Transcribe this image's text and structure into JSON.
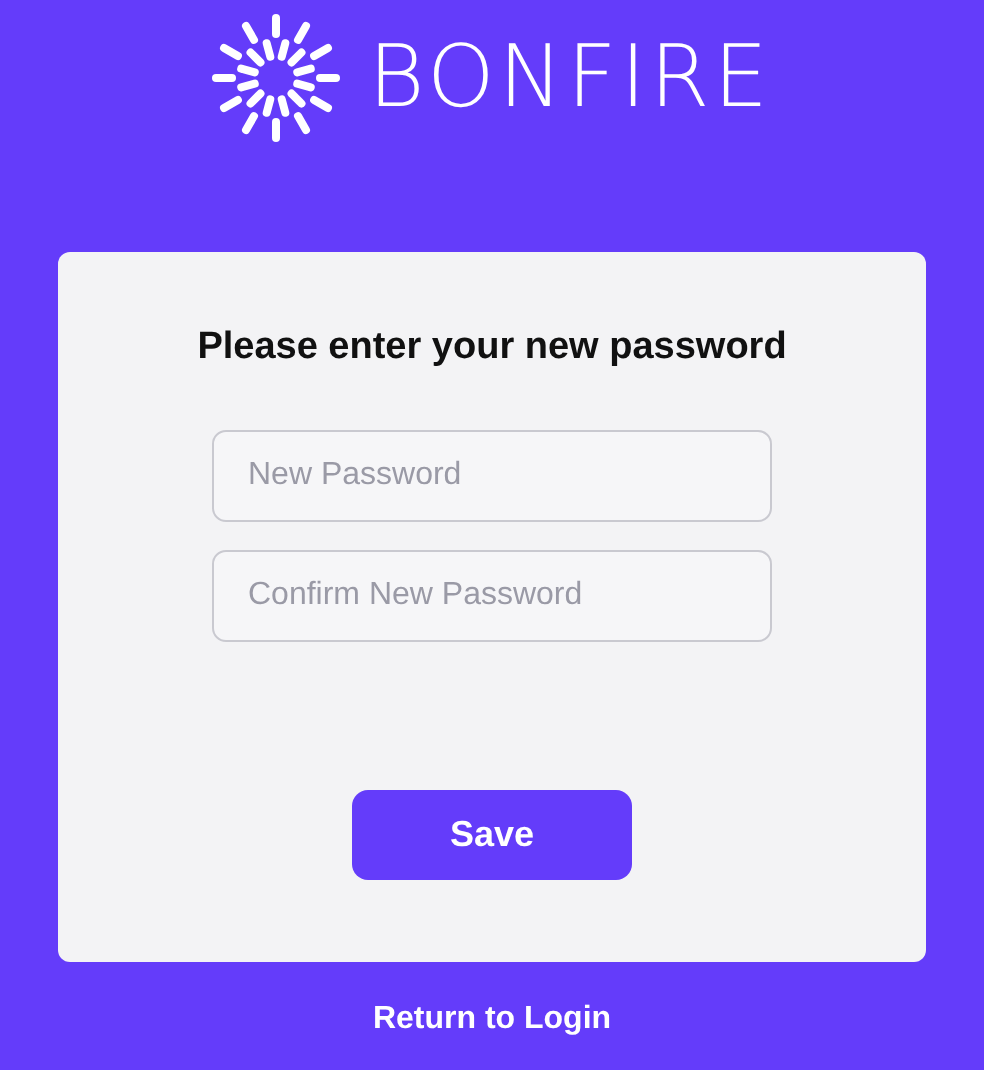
{
  "brand": "BONFIRE",
  "form": {
    "title": "Please enter your new password",
    "fields": [
      {
        "placeholder": "New Password"
      },
      {
        "placeholder": "Confirm New Password"
      }
    ],
    "submit": "Save"
  },
  "footer_link": "Return to Login"
}
